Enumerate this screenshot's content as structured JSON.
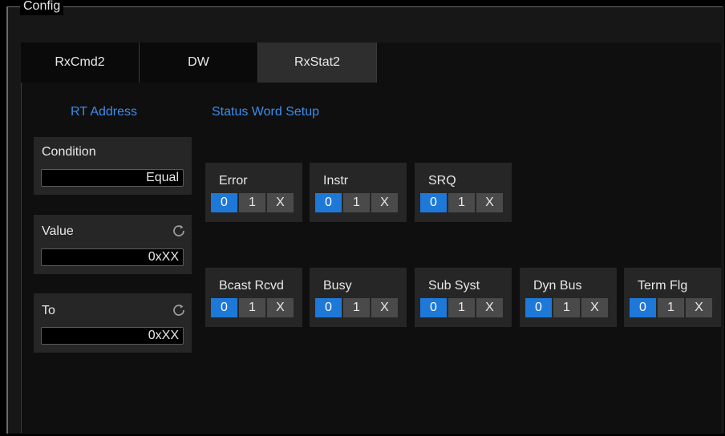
{
  "frame": {
    "title": "Config"
  },
  "tabs": [
    {
      "label": "RxCmd2",
      "active": false
    },
    {
      "label": "DW",
      "active": false
    },
    {
      "label": "RxStat2",
      "active": true
    }
  ],
  "left": {
    "title": "RT Address",
    "condition": {
      "label": "Condition",
      "value": "Equal"
    },
    "value": {
      "label": "Value",
      "value": "0xXX"
    },
    "to": {
      "label": "To",
      "value": "0xXX"
    }
  },
  "right": {
    "title": "Status Word Setup",
    "options": [
      "0",
      "1",
      "X"
    ],
    "bits": [
      {
        "label": "Error",
        "selected": "0"
      },
      {
        "label": "Instr",
        "selected": "0"
      },
      {
        "label": "SRQ",
        "selected": "0"
      },
      {
        "label": "Bcast Rcvd",
        "selected": "0"
      },
      {
        "label": "Busy",
        "selected": "0"
      },
      {
        "label": "Sub Syst",
        "selected": "0"
      },
      {
        "label": "Dyn Bus",
        "selected": "0"
      },
      {
        "label": "Term Flg",
        "selected": "0"
      }
    ]
  },
  "colors": {
    "accent": "#1e78d8",
    "title": "#3b8ded",
    "panel": "#262626"
  }
}
